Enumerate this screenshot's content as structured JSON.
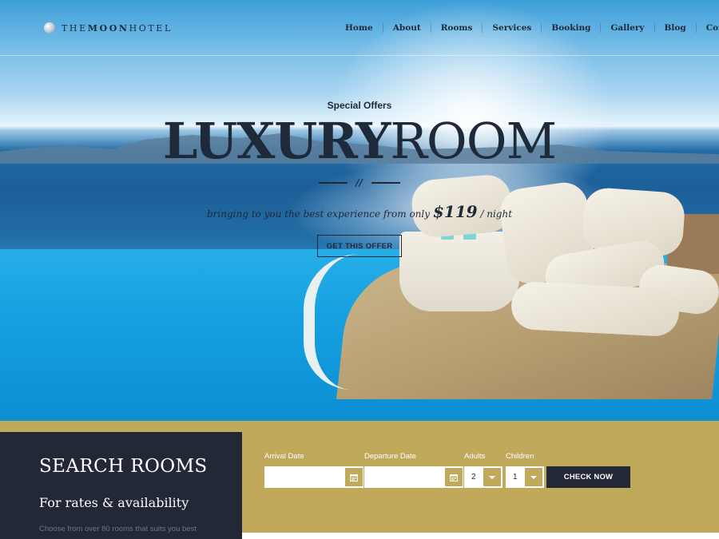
{
  "brand": {
    "logo_pre": "THE",
    "logo_mid": "MOON",
    "logo_post": "HOTEL"
  },
  "nav": {
    "items": [
      {
        "label": "Home"
      },
      {
        "label": "About"
      },
      {
        "label": "Rooms"
      },
      {
        "label": "Services"
      },
      {
        "label": "Booking"
      },
      {
        "label": "Gallery"
      },
      {
        "label": "Blog"
      },
      {
        "label": "Contact"
      }
    ]
  },
  "hero": {
    "kicker": "Special Offers",
    "headline_bold": "LUXURY",
    "headline_light": "ROOM",
    "divider_mark": "//",
    "tagline_pre": "bringing to you the best experience from only",
    "tagline_price": "$119",
    "tagline_post": "/ night",
    "cta_label": "GET THIS OFFER"
  },
  "search": {
    "title": "SEARCH ROOMS",
    "subtitle": "For rates & availability",
    "note": "Choose from over 80 rooms that suits you best"
  },
  "booking": {
    "arrival_label": "Arrival Date",
    "arrival_value": "",
    "departure_label": "Departure Date",
    "departure_value": "",
    "adults_label": "Adults",
    "adults_value": "2",
    "children_label": "Children",
    "children_value": "1",
    "submit_label": "CHECK NOW"
  },
  "colors": {
    "accent_gold": "#c0a95a",
    "dark_navy": "#232836",
    "text_dark": "#1e2a3a"
  }
}
